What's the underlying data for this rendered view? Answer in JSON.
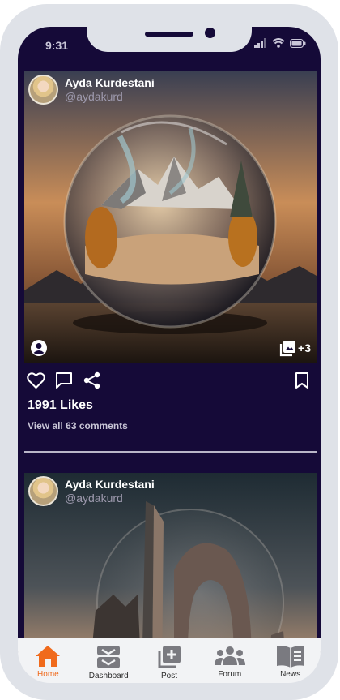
{
  "status_bar": {
    "time": "9:31"
  },
  "posts": [
    {
      "author_name": "Ayda Kurdestani",
      "author_handle": "@aydakurd",
      "gallery_more": "+3",
      "likes": "1991 Likes",
      "comments": "View all 63 comments"
    },
    {
      "author_name": "Ayda Kurdestani",
      "author_handle": "@aydakurd"
    }
  ],
  "tabs": [
    {
      "label": "Home",
      "icon": "home-icon",
      "active": true
    },
    {
      "label": "Dashboard",
      "icon": "dashboard-icon",
      "active": false
    },
    {
      "label": "Post",
      "icon": "add-post-icon",
      "active": false
    },
    {
      "label": "Forum",
      "icon": "forum-icon",
      "active": false
    },
    {
      "label": "News",
      "icon": "news-icon",
      "active": false
    }
  ],
  "colors": {
    "background": "#150a38",
    "accent": "#f06a1c",
    "tabbar": "#f2f3f5"
  }
}
